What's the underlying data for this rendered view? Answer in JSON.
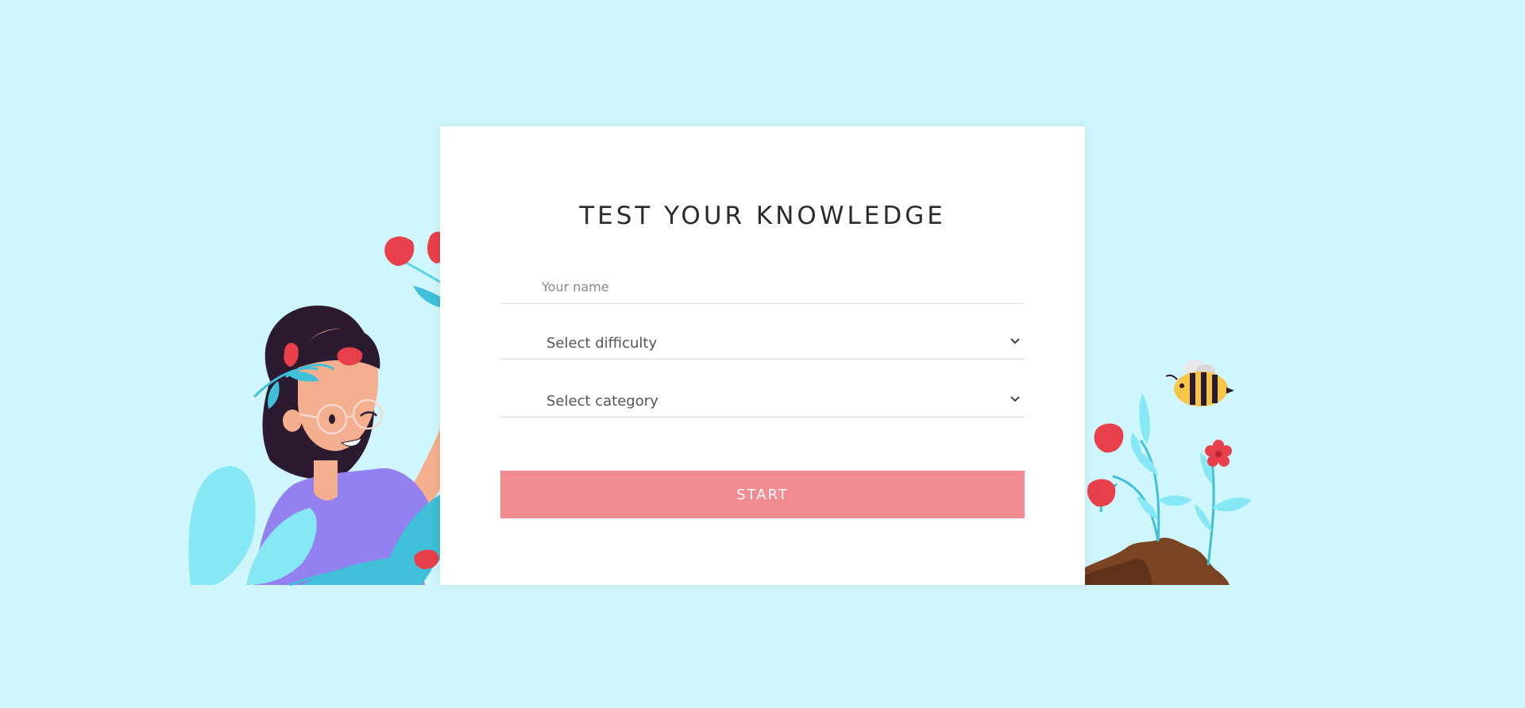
{
  "quiz": {
    "title": "TEST YOUR KNOWLEDGE",
    "name_placeholder": "Your name",
    "difficulty_label": "Select difficulty",
    "category_label": "Select category",
    "start_label": "START"
  },
  "colors": {
    "background": "#cff6fd",
    "card": "#ffffff",
    "start_button": "#f28b91",
    "tulip_red": "#e8404a",
    "leaf_blue": "#3fc0d8",
    "soil": "#7b4422"
  },
  "icons": {
    "select_arrow": "chevron-down-icon"
  }
}
